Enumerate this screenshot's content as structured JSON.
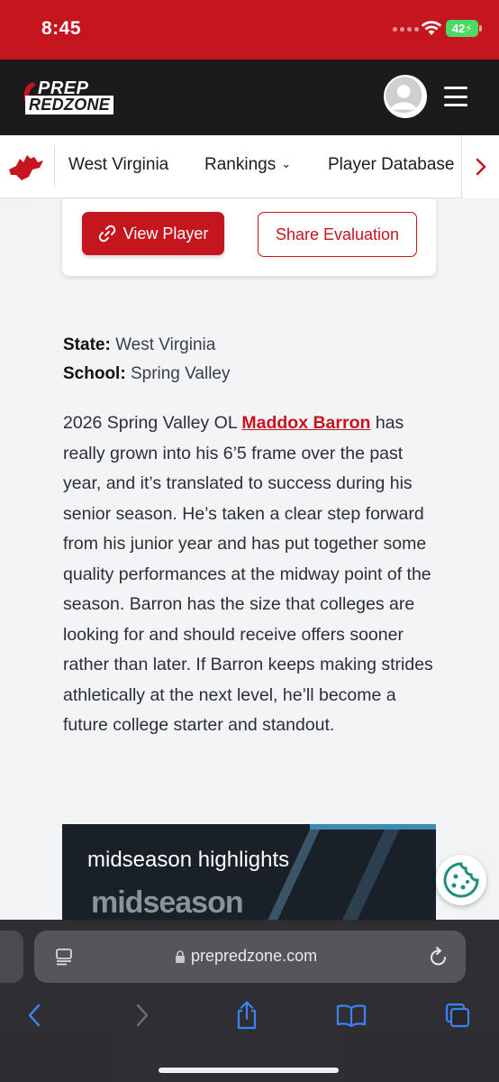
{
  "status": {
    "time": "8:45",
    "battery": "42"
  },
  "brand": {
    "line1": "PREP",
    "line2": "REDZONE"
  },
  "nav": {
    "items": [
      {
        "label": "West Virginia"
      },
      {
        "label": "Rankings"
      },
      {
        "label": "Player Database"
      }
    ]
  },
  "actions": {
    "view_player": "View Player",
    "share": "Share Evaluation"
  },
  "meta": {
    "state_label": "State:",
    "state_value": "West Virginia",
    "school_label": "School:",
    "school_value": "Spring Valley"
  },
  "article": {
    "lead": "2026 Spring Valley OL ",
    "player_name": "Maddox Barron",
    "body": "has really grown into his 6’5 frame over the past year, and it’s translated to success during his senior season. He’s taken a clear step forward from his junior year and has put together some quality performances at the midway point of the season. Barron has the size that colleges are looking for and should receive offers sooner rather than later. If Barron keeps making strides athletically at the next level, he’ll become a future college starter and standout."
  },
  "video": {
    "title": "midseason highlights",
    "overlay_text": "midseason"
  },
  "browser": {
    "url": "prepredzone.com"
  },
  "colors": {
    "brand_red": "#c5151f",
    "header_dark": "#1b1b1b",
    "cookie_teal": "#1f8f7a"
  }
}
